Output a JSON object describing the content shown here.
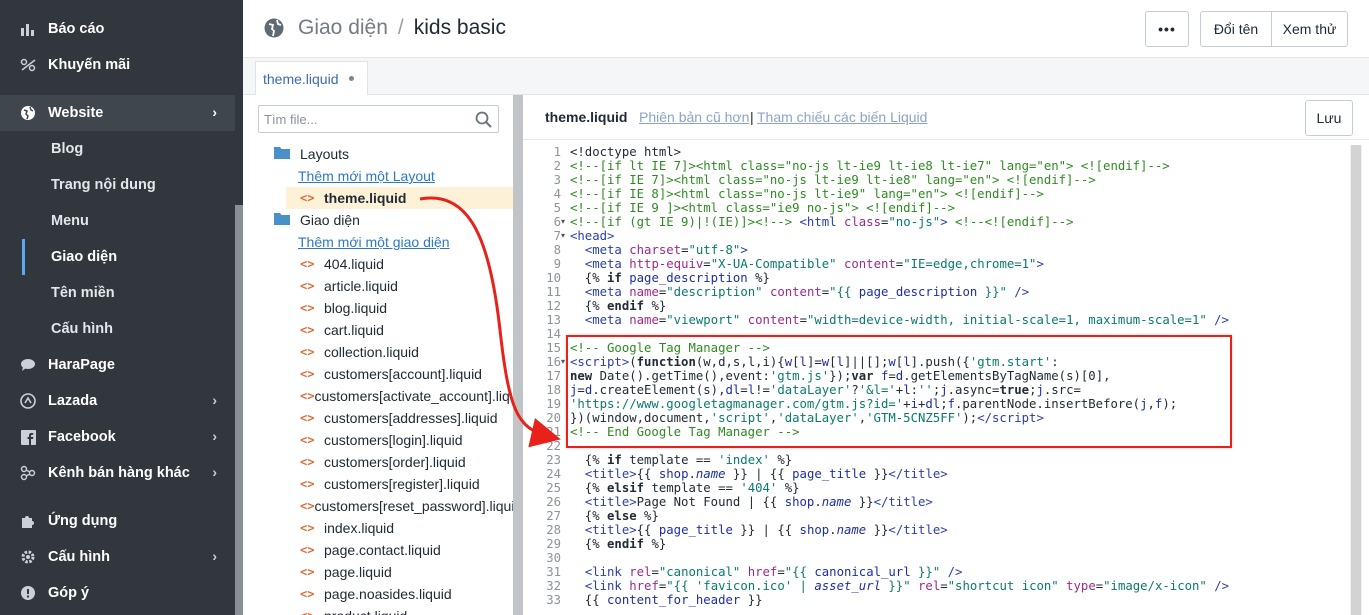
{
  "sidebar": {
    "items": [
      {
        "label": "Báo cáo",
        "icon": "bar-chart-icon"
      },
      {
        "label": "Khuyến mãi",
        "icon": "tag-icon"
      },
      {
        "label": "Website",
        "icon": "globe-icon"
      },
      {
        "label": "HaraPage",
        "icon": "chat-bubble-icon"
      },
      {
        "label": "Lazada",
        "icon": "lazada-icon"
      },
      {
        "label": "Facebook",
        "icon": "facebook-icon"
      },
      {
        "label": "Kênh bán hàng khác",
        "icon": "channels-icon"
      },
      {
        "label": "Ứng dụng",
        "icon": "puzzle-icon"
      },
      {
        "label": "Cấu hình",
        "icon": "gear-icon"
      },
      {
        "label": "Góp ý",
        "icon": "feedback-icon"
      }
    ],
    "website_sub": [
      "Blog",
      "Trang nội dung",
      "Menu",
      "Giao diện",
      "Tên miền",
      "Cấu hình"
    ]
  },
  "header": {
    "section": "Giao diện",
    "separator": "/",
    "current": "kids basic",
    "more_label": "•••",
    "rename_label": "Đổi tên",
    "preview_label": "Xem thử"
  },
  "tab": {
    "label": "theme.liquid"
  },
  "tree": {
    "search_placeholder": "Tìm file...",
    "layouts_label": "Layouts",
    "add_layout": "Thêm mới một Layout",
    "selected_file": "theme.liquid",
    "themes_label": "Giao diện",
    "add_theme": "Thêm mới một giao diện",
    "files": [
      "404.liquid",
      "article.liquid",
      "blog.liquid",
      "cart.liquid",
      "collection.liquid",
      "customers[account].liquid",
      "customers[activate_account].liquid",
      "customers[addresses].liquid",
      "customers[login].liquid",
      "customers[order].liquid",
      "customers[register].liquid",
      "customers[reset_password].liquid",
      "index.liquid",
      "page.contact.liquid",
      "page.liquid",
      "page.noasides.liquid",
      "product.liquid"
    ]
  },
  "editor": {
    "filename": "theme.liquid",
    "older_versions": "Phiên bản cũ hơn",
    "pipe": "|",
    "liquid_ref": "Tham chiếu các biến Liquid",
    "save_label": "Lưu",
    "line_numbers": [
      "1",
      "2",
      "3",
      "4",
      "5",
      "6",
      "7",
      "8",
      "9",
      "10",
      "11",
      "12",
      "13",
      "14",
      "15",
      "16",
      "17",
      "18",
      "19",
      "20",
      "21",
      "22",
      "23",
      "24",
      "25",
      "26",
      "27",
      "28",
      "29",
      "30",
      "31",
      "32",
      "33"
    ]
  },
  "colors": {
    "sidebar_bg": "#31373d",
    "highlight": "#e8221a",
    "selected_file_bg": "#fdf1d8",
    "link": "#2d79c7"
  }
}
